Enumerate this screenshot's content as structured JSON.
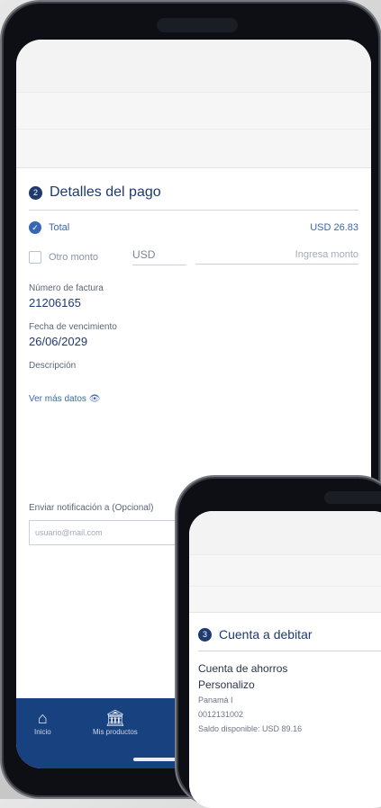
{
  "main": {
    "section_number": "2",
    "section_title": "Detalles del pago",
    "total_label": "Total",
    "total_amount": "USD 26.83",
    "other_amount_label": "Otro monto",
    "currency": "USD",
    "amount_placeholder": "Ingresa monto",
    "invoice_label": "Número de factura",
    "invoice_value": "21206165",
    "due_label": "Fecha de vencimiento",
    "due_value": "26/06/2029",
    "description_label": "Descripción",
    "more_link": "Ver más datos",
    "notify_label": "Enviar notificación a (Opcional)",
    "email_placeholder": "usuario@mail.com"
  },
  "bottom_nav": {
    "items": [
      {
        "label": "Inicio",
        "icon": "home-icon"
      },
      {
        "label": "Mis productos",
        "icon": "bank-icon"
      }
    ]
  },
  "overlay": {
    "section_number": "3",
    "section_title": "Cuenta a debitar",
    "account_type": "Cuenta de ahorros",
    "account_name": "Personalizo",
    "location": "Panamá I",
    "account_number": "0012131002",
    "balance": "Saldo disponible: USD 89.16"
  },
  "colors": {
    "primary": "#1e3a6e",
    "accent": "#3a67b4",
    "nav": "#17417f"
  }
}
